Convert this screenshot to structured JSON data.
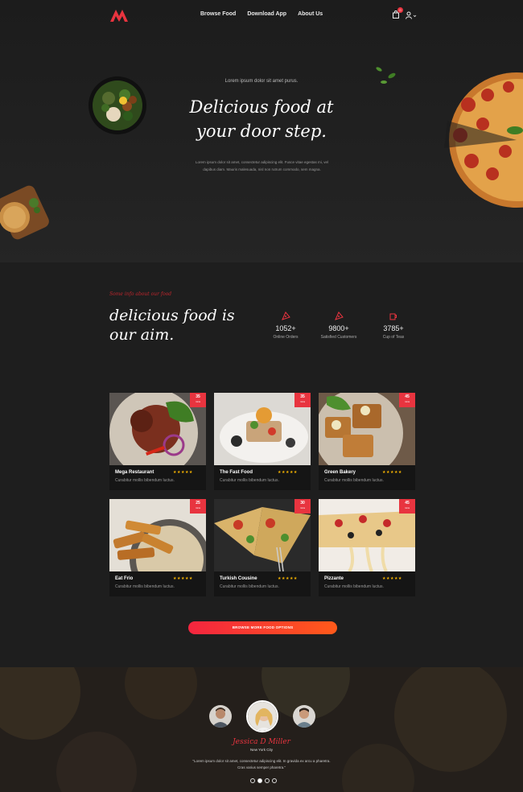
{
  "nav": {
    "links": [
      "Browse Food",
      "Download App",
      "About Us"
    ],
    "cart_count": "0"
  },
  "hero": {
    "subtitle": "Lorem ipsum dolor sit amet purus.",
    "title_line1": "Delicious food at",
    "title_line2": "your door step.",
    "text_line1": "Lorem ipsum dolor sit amet, consectetur adipiscing elit. Fusce vitae egestas mi, vel",
    "text_line2": "dapibus diam. Mauris malesuada, nisl non rutrum commodo, sem magna."
  },
  "about": {
    "kicker": "Some info about our food",
    "title_line1": "delicious food is",
    "title_line2": "our aim.",
    "stats": [
      {
        "value": "1052+",
        "label": "Online Orders",
        "icon": "pizza-slice-icon"
      },
      {
        "value": "9800+",
        "label": "Satisfied Customers",
        "icon": "pizza-slice-icon"
      },
      {
        "value": "3785+",
        "label": "Cup of Teas",
        "icon": "cup-icon"
      }
    ]
  },
  "cards": [
    {
      "name": "Mega Restaurant",
      "stars": "★★★★★",
      "desc": "Curabitur mollis bibendum luctus.",
      "badge": "35",
      "badge_unit": "mins"
    },
    {
      "name": "The Fast Food",
      "stars": "★★★★★",
      "desc": "Curabitur mollis bibendum luctus.",
      "badge": "35",
      "badge_unit": "mins"
    },
    {
      "name": "Green Bakery",
      "stars": "★★★★★",
      "desc": "Curabitur mollis bibendum luctus.",
      "badge": "45",
      "badge_unit": "mins"
    },
    {
      "name": "Eat Frio",
      "stars": "★★★★★",
      "desc": "Curabitur mollis bibendum luctus.",
      "badge": "25",
      "badge_unit": "mins"
    },
    {
      "name": "Turkish Cousine",
      "stars": "★★★★★",
      "desc": "Curabitur mollis bibendum luctus.",
      "badge": "30",
      "badge_unit": "mins"
    },
    {
      "name": "Pizzante",
      "stars": "★★★★★",
      "desc": "Curabitur mollis bibendum luctus.",
      "badge": "45",
      "badge_unit": "mins"
    }
  ],
  "browse_button": "BROWSE MORE FOOD OPTIONS",
  "testimonial": {
    "name": "Jessica D Miller",
    "city": "New York City",
    "quote_line1": "\"Lorem ipsum dolor sit amet, consectetur adipiscing elit. In gravida ex arcu a pharetra.",
    "quote_line2": "Cras varius semper pharetra.\""
  },
  "colors": {
    "accent": "#e8343f",
    "star": "#f5b301",
    "background": "#1e1e1e"
  }
}
